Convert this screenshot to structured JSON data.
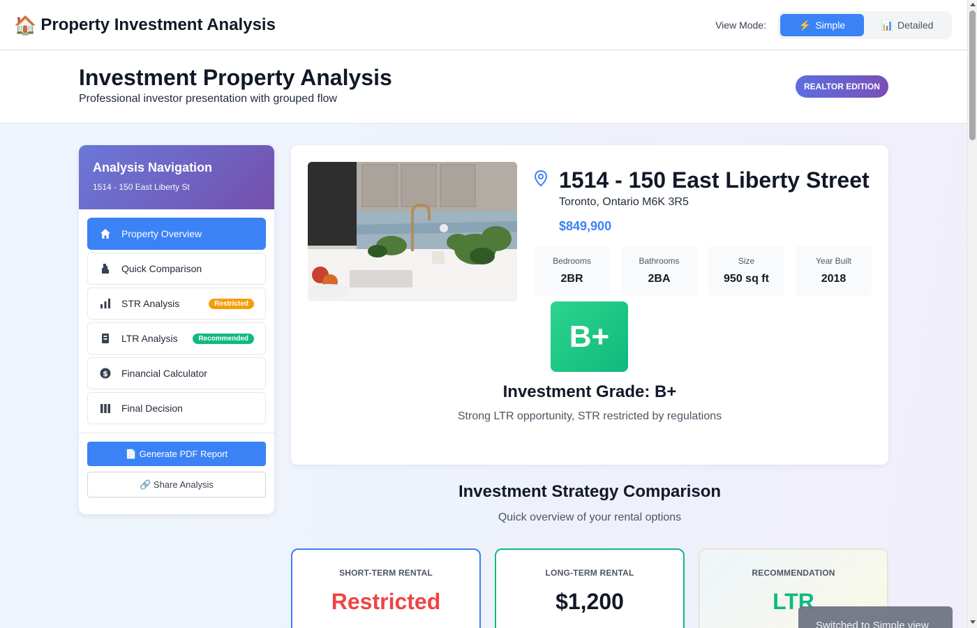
{
  "app": {
    "icon": "🏠",
    "title": "Property Investment Analysis",
    "view_mode_label": "View Mode:",
    "modes": [
      {
        "icon": "⚡",
        "label": "Simple",
        "active": true
      },
      {
        "icon": "📊",
        "label": "Detailed",
        "active": false
      }
    ]
  },
  "header": {
    "title": "Investment Property Analysis",
    "subtitle": "Professional investor presentation with grouped flow",
    "badge": "REALTOR EDITION"
  },
  "sidebar": {
    "title": "Analysis Navigation",
    "subtitle": "1514 - 150 East Liberty St",
    "items": [
      {
        "label": "Property Overview",
        "icon": "home-icon",
        "active": true
      },
      {
        "label": "Quick Comparison",
        "icon": "compare-icon"
      },
      {
        "label": "STR Analysis",
        "icon": "bar-chart-icon",
        "badge": "Restricted"
      },
      {
        "label": "LTR Analysis",
        "icon": "building-icon",
        "badge": "Recommended"
      },
      {
        "label": "Financial Calculator",
        "icon": "dollar-icon"
      },
      {
        "label": "Final Decision",
        "icon": "columns-icon"
      }
    ],
    "pdf_button": "📄 Generate PDF Report",
    "share_button": "🔗 Share Analysis"
  },
  "property": {
    "address": "1514 - 150 East Liberty Street",
    "city": "Toronto, Ontario M6K 3R5",
    "price": "$849,900",
    "stats": [
      {
        "label": "Bedrooms",
        "value": "2BR"
      },
      {
        "label": "Bathrooms",
        "value": "2BA"
      },
      {
        "label": "Size",
        "value": "950 sq ft"
      },
      {
        "label": "Year Built",
        "value": "2018"
      }
    ],
    "grade": "B+",
    "grade_title": "Investment Grade: B+",
    "grade_desc": "Strong LTR opportunity, STR restricted by regulations"
  },
  "comparison": {
    "title": "Investment Strategy Comparison",
    "subtitle": "Quick overview of your rental options",
    "cards": [
      {
        "label": "SHORT-TERM RENTAL",
        "value": "Restricted"
      },
      {
        "label": "LONG-TERM RENTAL",
        "value": "$1,200"
      },
      {
        "label": "RECOMMENDATION",
        "value": "LTR"
      }
    ]
  },
  "toast": "Switched to Simple view",
  "colors": {
    "accent": "#3b82f6",
    "success": "#10b981",
    "warning": "#f59e0b",
    "danger": "#ef4444"
  }
}
